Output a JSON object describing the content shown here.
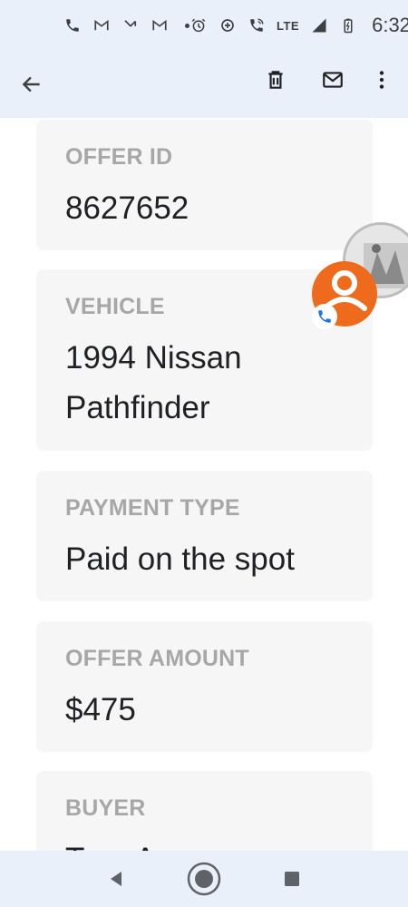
{
  "status_bar": {
    "network": "LTE",
    "time": "6:32",
    "icons": [
      "phone-icon",
      "gmail-icon",
      "missed-call-icon",
      "gmail-icon",
      "alarm-icon",
      "data-saver-icon",
      "wifi-calling-icon",
      "signal-icon",
      "battery-charging-icon"
    ]
  },
  "app_bar": {
    "icons": [
      "back-arrow-icon",
      "delete-icon",
      "mail-icon",
      "more-vert-icon"
    ]
  },
  "cards": [
    {
      "label": "OFFER ID",
      "value": "8627652"
    },
    {
      "label": "VEHICLE",
      "value_lines": [
        "1994 Nissan",
        "Pathfinder"
      ]
    },
    {
      "label": "PAYMENT TYPE",
      "value": "Paid on the spot"
    },
    {
      "label": "OFFER AMOUNT",
      "value": "$475"
    },
    {
      "label": "BUYER",
      "value": "Tu... Au..."
    }
  ],
  "colors": {
    "bar_bg": "#eaf0f9",
    "card_bg": "#f6f6f6",
    "label": "#a7a7a7",
    "value": "#202124",
    "contact_accent": "#ee6a1d",
    "call_badge": "#1a73e8"
  },
  "nav_bar": {
    "icons": [
      "nav-back-icon",
      "nav-home-icon",
      "nav-recents-icon"
    ]
  }
}
